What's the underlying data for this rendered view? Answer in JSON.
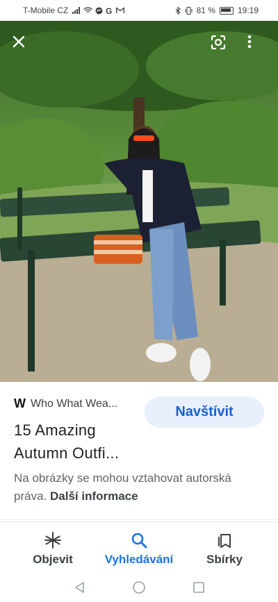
{
  "status_bar": {
    "carrier": "T-Mobile CZ",
    "battery_percent": "81 %",
    "time": "19:19"
  },
  "image_viewer": {
    "close_icon": "close-icon",
    "lens_icon": "google-lens-icon",
    "menu_icon": "more-vert-icon"
  },
  "result": {
    "source_name": "Who What Wea...",
    "source_logo": "W",
    "title_line1": "15 Amazing",
    "title_line2": "Autumn Outfi...",
    "visit_label": "Navštívit",
    "rights_text": "Na obrázky se mohou vztahovat autorská práva.",
    "rights_link": "Další informace"
  },
  "bottom_nav": {
    "items": [
      {
        "label": "Objevit",
        "icon": "asterisk-icon"
      },
      {
        "label": "Vyhledávání",
        "icon": "search-icon"
      },
      {
        "label": "Sbírky",
        "icon": "collections-icon"
      }
    ],
    "active_index": 1
  },
  "colors": {
    "accent": "#1a73e8",
    "visit_bg": "#e8f0fe"
  }
}
